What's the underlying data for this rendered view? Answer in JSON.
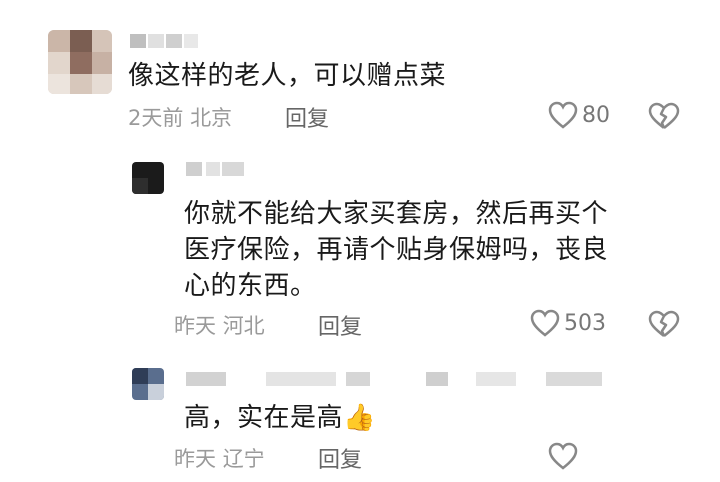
{
  "comments": [
    {
      "text_lines": [
        "像这样的老人，可以赠点菜"
      ],
      "time": "2天前",
      "location": "北京",
      "reply_label": "回复",
      "likes": "80"
    },
    {
      "text_lines": [
        "你就不能给大家买套房，然后再买个",
        "医疗保险，再请个贴身保姆吗，丧良",
        "心的东西。"
      ],
      "time": "昨天",
      "location": "河北",
      "reply_label": "回复",
      "likes": "503"
    },
    {
      "text_lines": [
        "高，实在是高"
      ],
      "emoji": "👍",
      "time": "昨天",
      "location": "辽宁",
      "reply_label": "回复"
    }
  ],
  "colors": {
    "meta": "#9a9a9a",
    "text": "#1a1a1a",
    "icon": "#888888"
  }
}
